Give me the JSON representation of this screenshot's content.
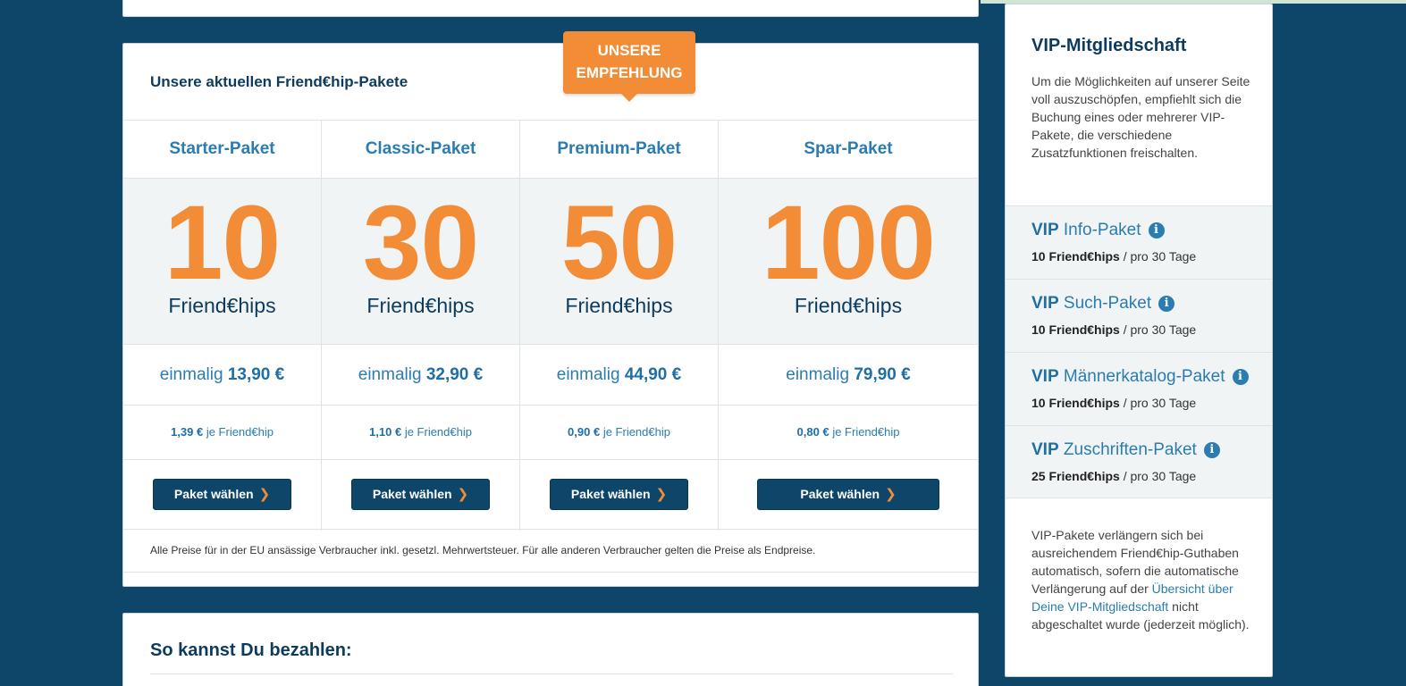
{
  "colors": {
    "background": "#0d4669",
    "accent": "#f28c36",
    "link_blue": "#2b7cb0",
    "button": "#0d4669"
  },
  "packages_card": {
    "title": "Unsere aktuellen Friend€hip-Pakete",
    "badge_line1": "UNSERE",
    "badge_line2": "EMPFEHLUNG",
    "packages": [
      {
        "name": "Starter-Paket",
        "quantity": "10",
        "unit": "Friend€hips",
        "price_prefix": "einmalig",
        "price": "13,90 €",
        "per_price": "1,39 €",
        "per_label": "je Friend€hip",
        "button": "Paket wählen",
        "chevron_icon": "chevron-right-icon"
      },
      {
        "name": "Classic-Paket",
        "quantity": "30",
        "unit": "Friend€hips",
        "price_prefix": "einmalig",
        "price": "32,90 €",
        "per_price": "1,10 €",
        "per_label": "je Friend€hip",
        "button": "Paket wählen",
        "chevron_icon": "chevron-right-icon"
      },
      {
        "name": "Premium-Paket",
        "quantity": "50",
        "unit": "Friend€hips",
        "price_prefix": "einmalig",
        "price": "44,90 €",
        "per_price": "0,90 €",
        "per_label": "je Friend€hip",
        "button": "Paket wählen",
        "chevron_icon": "chevron-right-icon"
      },
      {
        "name": "Spar-Paket",
        "quantity": "100",
        "unit": "Friend€hips",
        "price_prefix": "einmalig",
        "price": "79,90 €",
        "per_price": "0,80 €",
        "per_label": "je Friend€hip",
        "button": "Paket wählen",
        "chevron_icon": "chevron-right-icon"
      }
    ],
    "disclaimer": "Alle Preise für in der EU ansässige Verbraucher inkl. gesetzl. Mehrwertsteuer. Für alle anderen Verbraucher gelten die Preise als Endpreise."
  },
  "payment_card": {
    "title": "So kannst Du bezahlen:"
  },
  "vip_sidebar": {
    "title": "VIP-Mitgliedschaft",
    "intro": "Um die Möglichkeiten auf unserer Seite voll auszuschöpfen, empfiehlt sich die Buchung eines oder mehrerer VIP-Pakete, die verschiedene Zusatzfunktionen freischalten.",
    "items": [
      {
        "prefix": "VIP",
        "name": "Info-Paket",
        "icon": "info-icon",
        "amount": "10 Friend€hips",
        "period": "/ pro 30 Tage"
      },
      {
        "prefix": "VIP",
        "name": "Such-Paket",
        "icon": "info-icon",
        "amount": "10 Friend€hips",
        "period": "/ pro 30 Tage"
      },
      {
        "prefix": "VIP",
        "name": "Männerkatalog-Paket",
        "icon": "info-icon",
        "amount": "10 Friend€hips",
        "period": "/ pro 30 Tage"
      },
      {
        "prefix": "VIP",
        "name": "Zuschriften-Paket",
        "icon": "info-icon",
        "amount": "25 Friend€hips",
        "period": "/ pro 30 Tage"
      }
    ],
    "note_before": "VIP-Pakete verlängern sich bei ausreichendem Friend€hip-Guthaben automatisch, sofern die automatische Verlängerung auf der ",
    "note_link": "Übersicht über Deine VIP-Mitgliedschaft",
    "note_after": " nicht abgeschaltet wurde (jederzeit möglich)."
  }
}
